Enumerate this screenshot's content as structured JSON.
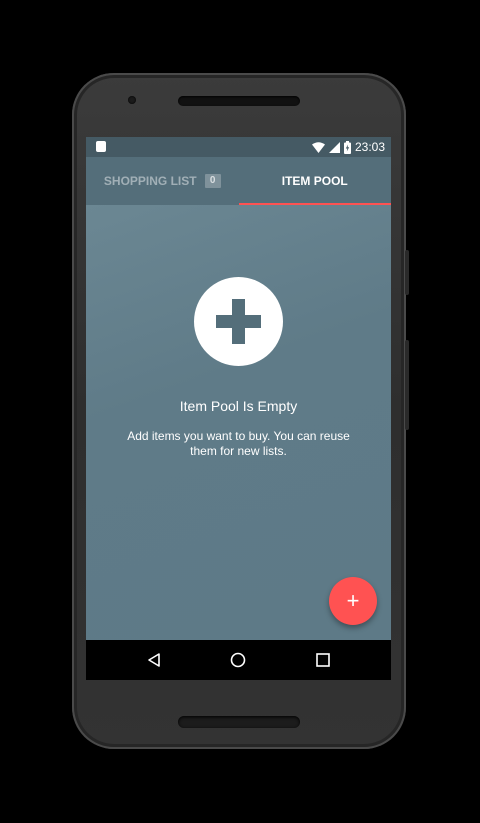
{
  "status_bar": {
    "time": "23:03",
    "icons": [
      "android-notification-icon",
      "wifi-icon",
      "signal-icon",
      "battery-charging-icon"
    ]
  },
  "tabs": [
    {
      "label": "SHOPPING LIST",
      "badge": "0",
      "active": false
    },
    {
      "label": "ITEM POOL",
      "active": true
    }
  ],
  "empty_state": {
    "icon": "plus-icon",
    "title": "Item Pool Is Empty",
    "description": "Add items you want to buy. You can reuse them for new lists."
  },
  "fab": {
    "icon": "plus-icon",
    "label": "+"
  },
  "nav": {
    "icons": [
      "back-icon",
      "home-icon",
      "recents-icon"
    ]
  },
  "colors": {
    "app_bar": "#546e7a",
    "status_bar": "#455a64",
    "background": "#607d8b",
    "accent": "#ff5252"
  }
}
